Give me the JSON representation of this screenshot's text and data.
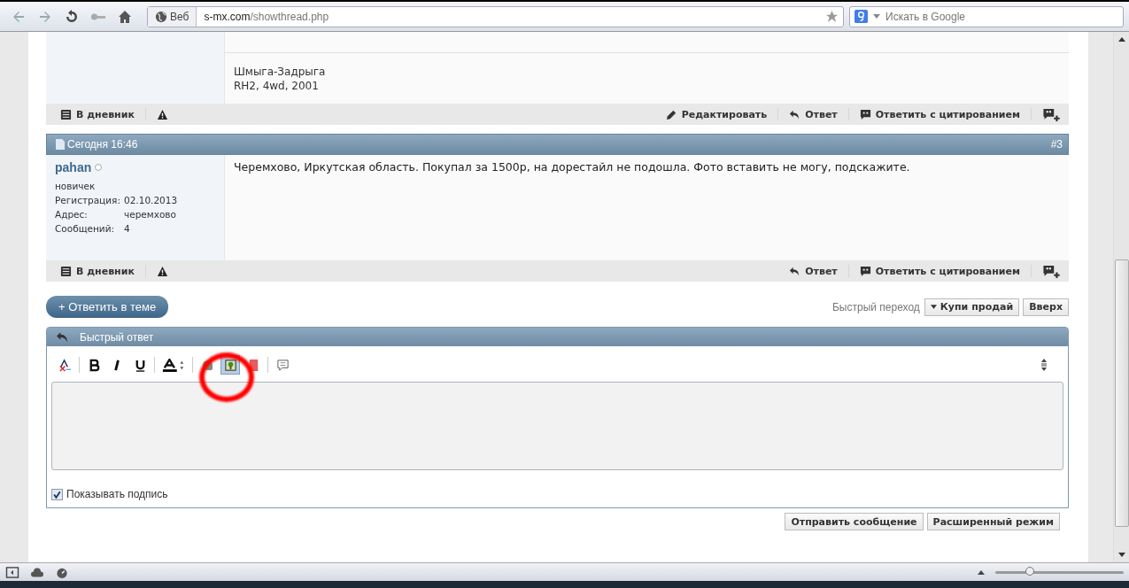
{
  "browser": {
    "address_label": "Веб",
    "url_host": "s-mx.com",
    "url_path": "/showthread.php",
    "search_placeholder": "Искать в Google"
  },
  "post_previous": {
    "signature": [
      "Шмыга-Задрыга",
      "RH2, 4wd, 2001"
    ],
    "footer_left": [
      {
        "kind": "diary",
        "label": "В дневник"
      },
      {
        "kind": "report"
      }
    ],
    "footer_right": [
      {
        "kind": "edit",
        "label": "Редактировать"
      },
      {
        "kind": "reply",
        "label": "Ответ"
      },
      {
        "kind": "quote",
        "label": "Ответить с цитированием"
      },
      {
        "kind": "multiquote"
      }
    ]
  },
  "post": {
    "date": "Сегодня 16:46",
    "number": "#3",
    "username": "pahan",
    "online": false,
    "rank": "новичек",
    "details": [
      {
        "label": "Регистрация:",
        "value": "02.10.2013"
      },
      {
        "label": "Адрес:",
        "value": "черемхово"
      },
      {
        "label": "Сообщений:",
        "value": "4"
      }
    ],
    "message": "Черемхово, Иркутская область. Покупал за 1500р, на дорестайл не подошла. Фото вставить не могу, подскажите.",
    "footer_left": [
      {
        "kind": "diary",
        "label": "В дневник"
      },
      {
        "kind": "report"
      }
    ],
    "footer_right": [
      {
        "kind": "reply",
        "label": "Ответ"
      },
      {
        "kind": "quote",
        "label": "Ответить с цитированием"
      },
      {
        "kind": "multiquote"
      }
    ]
  },
  "reply_thread_button": "+ Ответить в теме",
  "quick_nav": {
    "label": "Быстрый переход",
    "forum": "Купи продай",
    "top": "Вверх"
  },
  "quick_reply": {
    "title": "Быстрый ответ",
    "tools": [
      {
        "kind": "removeformat",
        "highlighted": false
      },
      {
        "kind": "sep"
      },
      {
        "kind": "bold",
        "highlighted": false
      },
      {
        "kind": "italic",
        "highlighted": false
      },
      {
        "kind": "underline",
        "highlighted": false
      },
      {
        "kind": "sep"
      },
      {
        "kind": "color",
        "highlighted": false
      },
      {
        "kind": "sep"
      },
      {
        "kind": "link",
        "highlighted": false
      },
      {
        "kind": "image",
        "highlighted": true
      },
      {
        "kind": "video",
        "highlighted": false
      },
      {
        "kind": "sep"
      },
      {
        "kind": "quote",
        "highlighted": false
      }
    ],
    "show_signature": {
      "label": "Показывать подпись",
      "checked": true
    },
    "buttons": [
      "Отправить сообщение",
      "Расширенный режим"
    ]
  },
  "zoom": {
    "level": 0.27
  }
}
